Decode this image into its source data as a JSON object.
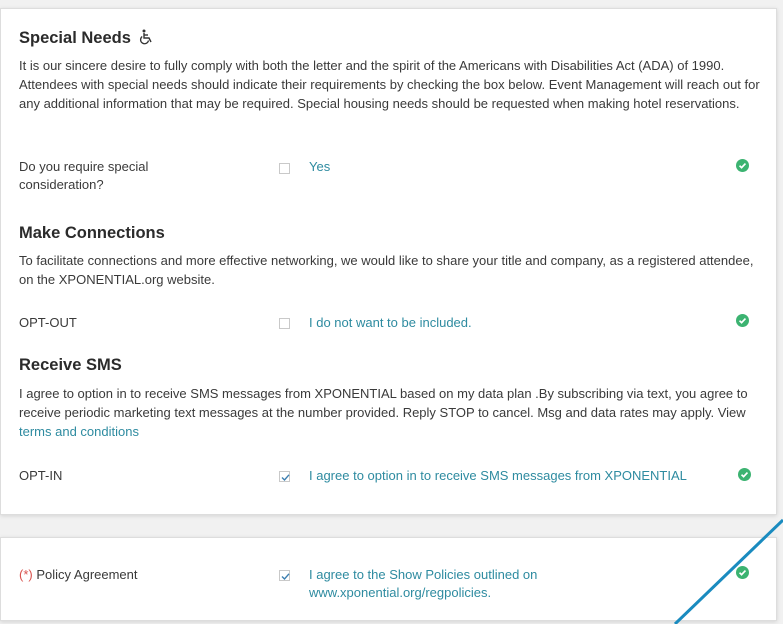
{
  "special_needs": {
    "heading": "Special Needs",
    "description": "It is our sincere desire to fully comply with both the letter and the spirit of the Americans with Disabilities Act (ADA) of 1990. Attendees with special needs should indicate their requirements by checking the box below. Event Management will reach out for any additional information that may be required. Special housing needs should be requested when making hotel reservations.",
    "question": "Do you require special consideration?",
    "option_label": "Yes",
    "checked": false,
    "icon": "wheelchair-icon"
  },
  "make_connections": {
    "heading": "Make Connections",
    "description": "To facilitate connections and more effective networking, we would like to share your title and company, as a registered attendee, on the XPONENTIAL.org website.",
    "field_label": "OPT-OUT",
    "option_label": "I do not want to be included.",
    "checked": false
  },
  "receive_sms": {
    "heading": "Receive SMS",
    "description": "I agree to option in to receive SMS messages from XPONENTIAL based on my data plan .By subscribing via text, you agree to receive periodic marketing text messages at the number provided. Reply STOP to cancel. Msg and data rates may apply. View",
    "terms_link": "terms and conditions",
    "field_label": "OPT-IN",
    "option_label": "I agree to option in to receive SMS messages from XPONENTIAL",
    "checked": true
  },
  "policy": {
    "required_marker": "(*)",
    "field_label": "Policy Agreement",
    "option_label": "I agree to the Show Policies outlined on www.xponential.org/regpolicies.",
    "checked": true
  },
  "colors": {
    "link": "#2e8ba0",
    "valid_check": "#3cb371",
    "required": "#d9534f",
    "annotation_line": "#1a8bbf"
  },
  "icons": [
    "wheelchair-icon",
    "valid-check-icon",
    "checkbox-check-icon"
  ]
}
